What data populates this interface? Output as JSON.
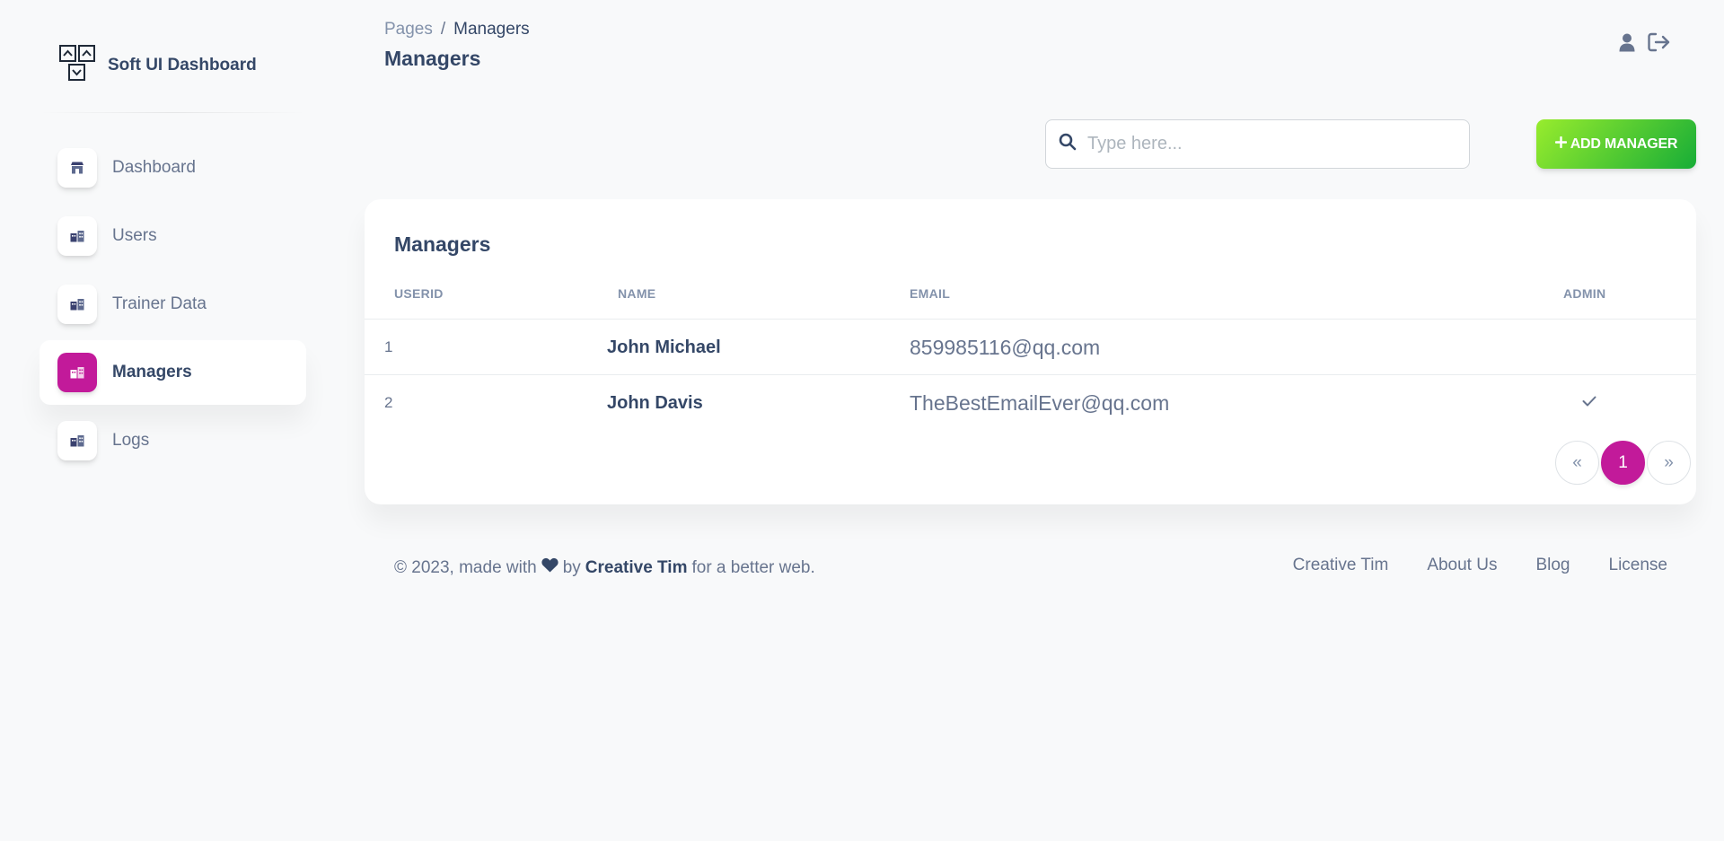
{
  "brand": {
    "name": "Soft UI Dashboard",
    "logo_icon": "dashboard-logo-icon"
  },
  "sidebar": {
    "items": [
      {
        "label": "Dashboard",
        "icon": "shop-icon",
        "active": false
      },
      {
        "label": "Users",
        "icon": "office-icon",
        "active": false
      },
      {
        "label": "Trainer Data",
        "icon": "office-icon",
        "active": false
      },
      {
        "label": "Managers",
        "icon": "office-icon",
        "active": true
      },
      {
        "label": "Logs",
        "icon": "office-icon",
        "active": false
      }
    ]
  },
  "header": {
    "breadcrumb": {
      "parent": "Pages",
      "separator": "/",
      "current": "Managers"
    },
    "title": "Managers",
    "icons": [
      "user-icon",
      "sign-out-icon"
    ]
  },
  "toolbar": {
    "search_placeholder": "Type here...",
    "add_label": "ADD MANAGER"
  },
  "table": {
    "title": "Managers",
    "columns": [
      "USERID",
      "NAME",
      "EMAIL",
      "ADMIN"
    ],
    "rows": [
      {
        "id": "1",
        "name": "John Michael",
        "email": "859985116@qq.com",
        "admin": false
      },
      {
        "id": "2",
        "name": "John Davis",
        "email": "TheBestEmailEver@qq.com",
        "admin": true
      }
    ]
  },
  "pagination": {
    "prev": "«",
    "current": "1",
    "next": "»"
  },
  "footer": {
    "prefix": "© 2023, made with",
    "by": "by",
    "author": "Creative Tim",
    "suffix": "for a better web.",
    "links": [
      "Creative Tim",
      "About Us",
      "Blog",
      "License"
    ]
  },
  "colors": {
    "accent": "#c21a9a",
    "text": "#344767",
    "muted": "#67748e",
    "add_button": "#98ec2d"
  }
}
